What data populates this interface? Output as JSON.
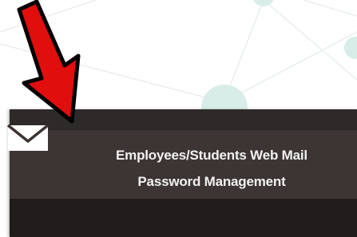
{
  "menu": {
    "item": {
      "icon": "mail-icon",
      "label_line1": "Employees/Students Web Mail",
      "label_line2": "Password Management"
    }
  },
  "annotation": {
    "icon": "red-arrow-icon",
    "color": "#e10e0e"
  },
  "colors": {
    "panel": "#2f2a2a",
    "item_bg": "#3c3533",
    "text": "#f2f2f2",
    "network_nodes": "#d8ece8"
  }
}
